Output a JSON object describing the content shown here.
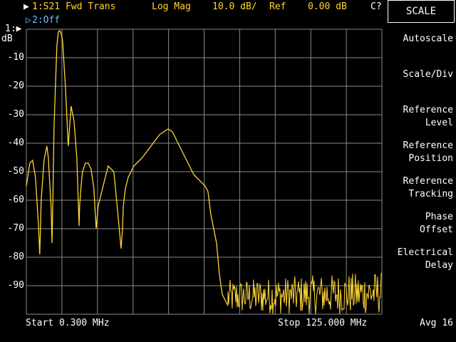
{
  "header": {
    "ch1_marker": "▶",
    "ch1_label": "1:S21 Fwd Trans",
    "format": "Log Mag",
    "scale": "10.0 dB/",
    "ref_label": "Ref",
    "ref_value": "0.00 dB",
    "correction": "C?",
    "ch2_marker": "▷",
    "ch2_label": "2:Off"
  },
  "plot": {
    "trace_marker": "1:▶",
    "unit": "dB",
    "y_ticks": [
      "-10",
      "-20",
      "-30",
      "-40",
      "-50",
      "-60",
      "-70",
      "-80",
      "-90"
    ],
    "start_label": "Start 0.300 MHz",
    "stop_label": "Stop 125.000 MHz"
  },
  "softkeys": {
    "title": "SCALE",
    "items": [
      {
        "line1": "Autoscale",
        "line2": ""
      },
      {
        "line1": "Scale/Div",
        "line2": ""
      },
      {
        "line1": "Reference",
        "line2": "Level"
      },
      {
        "line1": "Reference",
        "line2": "Position"
      },
      {
        "line1": "Reference",
        "line2": "Tracking"
      },
      {
        "line1": "Phase",
        "line2": "Offset"
      },
      {
        "line1": "Electrical",
        "line2": "Delay"
      }
    ],
    "avg": "Avg 16"
  },
  "colors": {
    "trace": "#ffd633",
    "grid": "#8a8a8a",
    "ch2": "#66c0ff"
  },
  "chart_data": {
    "type": "line",
    "xlabel": "",
    "ylabel": "dB",
    "x_start_mhz": 0.3,
    "x_stop_mhz": 125.0,
    "ylim": [
      -100,
      0
    ],
    "grid": true,
    "series": [
      {
        "x": [
          0.3,
          1.5,
          2.5,
          3.5,
          4.5,
          5.0,
          5.2,
          5.5,
          6.5,
          7.5,
          8.0,
          9.0,
          9.3,
          9.6,
          10.0,
          10.5,
          11.0,
          11.5,
          12.0,
          12.5,
          13.0,
          14.0,
          15.0,
          16.0,
          17.0,
          18.0,
          18.5,
          18.8,
          19.0,
          19.5,
          20.0,
          21.0,
          22.0,
          23.0,
          24.0,
          24.5,
          24.8,
          25.5,
          27.0,
          29.0,
          31.0,
          32.5,
          33.5,
          34.0,
          34.3,
          35.0,
          36.0,
          38.0,
          41.0,
          44.0,
          47.0,
          50.0,
          51.5,
          53.0,
          55.0,
          57.0,
          59.0,
          61.0,
          63.0,
          64.0,
          65.0,
          67.0,
          68.0,
          69.0,
          70.0,
          70.5,
          71.0
        ],
        "y": [
          -55,
          -47,
          -46,
          -52,
          -68,
          -79,
          -72,
          -60,
          -46,
          -41,
          -45,
          -63,
          -75,
          -60,
          -35,
          -20,
          -6,
          -1,
          -0.5,
          -1.5,
          -4,
          -20,
          -41,
          -27,
          -32,
          -45,
          -60,
          -69,
          -62,
          -55,
          -50,
          -47,
          -47,
          -49,
          -56,
          -65,
          -70,
          -62,
          -56,
          -48,
          -50,
          -66,
          -77,
          -70,
          -62,
          -56,
          -52,
          -48,
          -45,
          -41,
          -37,
          -35,
          -36,
          -39,
          -43,
          -47,
          -51,
          -53,
          -55,
          -57,
          -65,
          -75,
          -86,
          -93,
          -95,
          -96,
          -97
        ]
      }
    ],
    "noise_floor": {
      "x_from": 71.0,
      "x_to": 125.0,
      "y_min": -100,
      "y_max": -86
    }
  }
}
